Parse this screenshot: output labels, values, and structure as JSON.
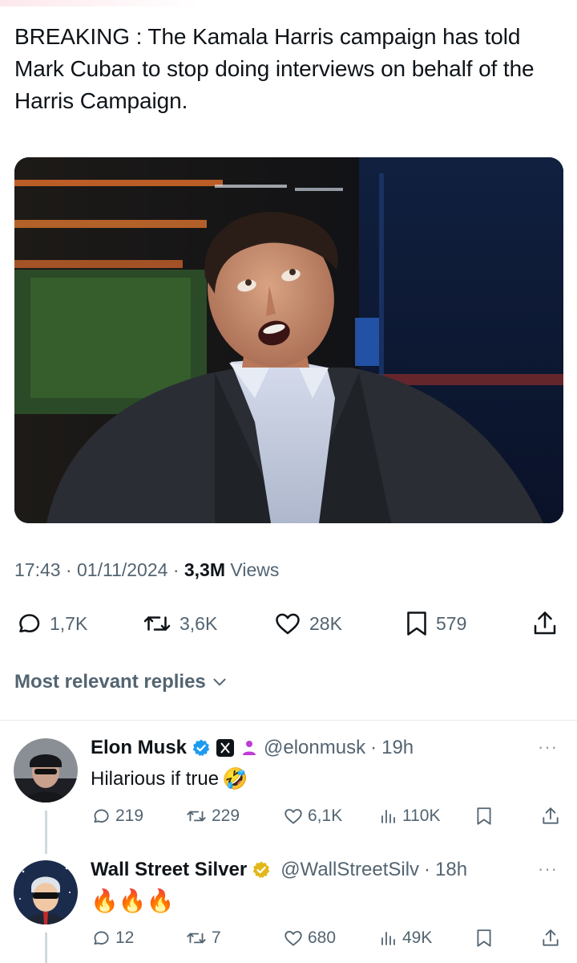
{
  "post": {
    "text": "BREAKING : The Kamala Harris campaign has told Mark Cuban to stop doing interviews on behalf of the Harris Campaign.",
    "time": "17:43",
    "date": "01/11/2024",
    "views_count": "3,3M",
    "views_label": "Views",
    "separator": "·",
    "actions": {
      "replies": "1,7K",
      "reposts": "3,6K",
      "likes": "28K",
      "bookmarks": "579"
    }
  },
  "replies_sort": {
    "label": "Most relevant replies"
  },
  "replies": [
    {
      "name": "Elon Musk",
      "handle": "@elonmusk",
      "time": "19h",
      "text": "Hilarious if true",
      "emoji": "🤣",
      "stats": {
        "replies": "219",
        "reposts": "229",
        "likes": "6,1K",
        "views": "110K"
      },
      "verified_color": "#1d9bf0"
    },
    {
      "name": "Wall Street Silver",
      "handle": "@WallStreetSilv",
      "time": "18h",
      "text": "🔥🔥🔥",
      "stats": {
        "replies": "12",
        "reposts": "7",
        "likes": "680",
        "views": "49K"
      },
      "verified_color": "#e2b719"
    }
  ],
  "more_dots": "···",
  "colors": {
    "text": "#0f1419",
    "muted": "#536471",
    "divider": "#e6e9ec"
  }
}
